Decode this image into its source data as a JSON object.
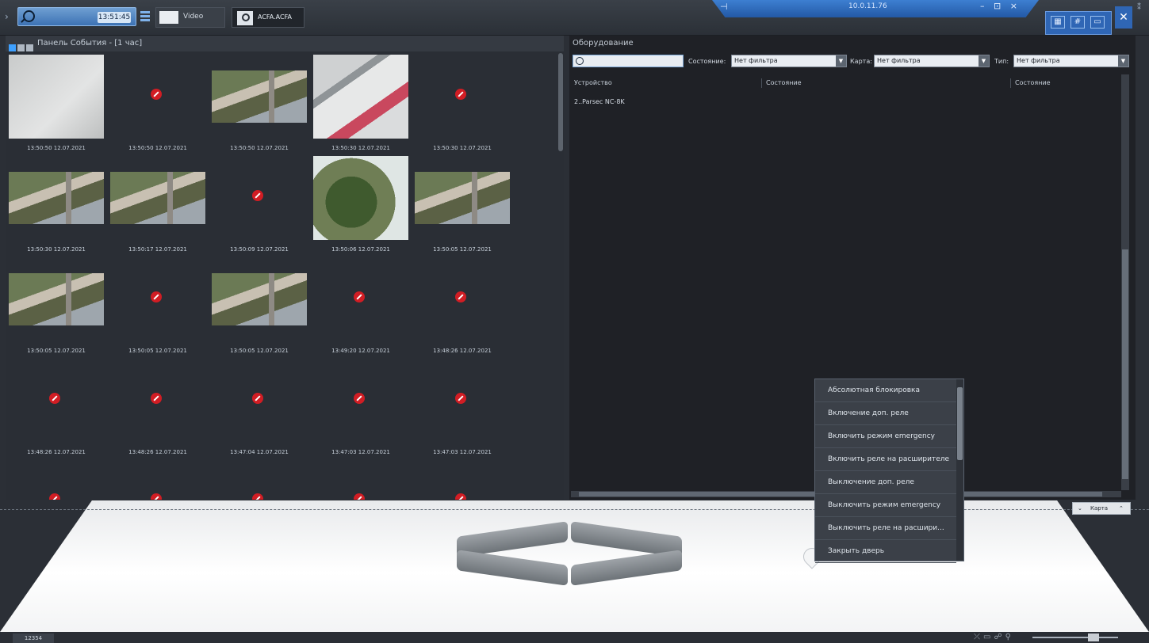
{
  "topbar": {
    "search_placeholder": "",
    "clock": "13:51:45",
    "tabs": [
      {
        "label": "Video"
      },
      {
        "label": "ACFA.ACFA"
      }
    ],
    "server_ip": "10.0.11.76",
    "window_controls": "– ⊡ ×"
  },
  "events": {
    "title": "Панель События - [1 час]",
    "rows": [
      [
        {
          "kind": "snow",
          "time": "13:50:50 12.07.2021"
        },
        {
          "kind": "none",
          "time": "13:50:50 12.07.2021"
        },
        {
          "kind": "street",
          "time": "13:50:50 12.07.2021"
        },
        {
          "kind": "cars",
          "time": "13:50:30 12.07.2021"
        },
        {
          "kind": "none",
          "time": "13:50:30 12.07.2021"
        }
      ],
      [
        {
          "kind": "street",
          "time": "13:50:30 12.07.2021"
        },
        {
          "kind": "street",
          "time": "13:50:17 12.07.2021"
        },
        {
          "kind": "none",
          "time": "13:50:09 12.07.2021"
        },
        {
          "kind": "tree",
          "time": "13:50:06 12.07.2021"
        },
        {
          "kind": "street",
          "time": "13:50:05 12.07.2021"
        }
      ],
      [
        {
          "kind": "street",
          "time": "13:50:05 12.07.2021"
        },
        {
          "kind": "none",
          "time": "13:50:05 12.07.2021"
        },
        {
          "kind": "street",
          "time": "13:50:05 12.07.2021"
        },
        {
          "kind": "none",
          "time": "13:49:20 12.07.2021"
        },
        {
          "kind": "none",
          "time": "13:48:26 12.07.2021"
        }
      ],
      [
        {
          "kind": "none",
          "time": "13:48:26 12.07.2021"
        },
        {
          "kind": "none",
          "time": "13:48:26 12.07.2021"
        },
        {
          "kind": "none",
          "time": "13:47:04 12.07.2021"
        },
        {
          "kind": "none",
          "time": "13:47:03 12.07.2021"
        },
        {
          "kind": "none",
          "time": "13:47:03 12.07.2021"
        }
      ]
    ]
  },
  "equipment": {
    "title": "Оборудование",
    "search_placeholder": "",
    "filters": {
      "state_label": "Состояние:",
      "state_value": "Нет фильтра",
      "map_label": "Карта:",
      "map_value": "Нет фильтра",
      "type_label": "Тип:",
      "type_value": "Нет фильтра"
    },
    "columns": [
      "Устройство",
      "Состояние",
      "Состояние"
    ],
    "devices": [
      {
        "name": "2..Parsec NC-8K"
      }
    ]
  },
  "context_menu": {
    "items": [
      "Абсолютная блокировка",
      "Включение доп. реле",
      "Включить режим emergency",
      "Включить реле на расширителе",
      "Выключение доп. реле",
      "Выключить режим emergency",
      "Выключить реле на расшири...",
      "Закрыть дверь"
    ]
  },
  "map": {
    "control_label": "Карта"
  },
  "statusbar": {
    "number": "12354"
  },
  "colors": {
    "accent": "#3d7fd1",
    "no_image": "#d11d24",
    "panel_bg": "#2a2e35"
  }
}
